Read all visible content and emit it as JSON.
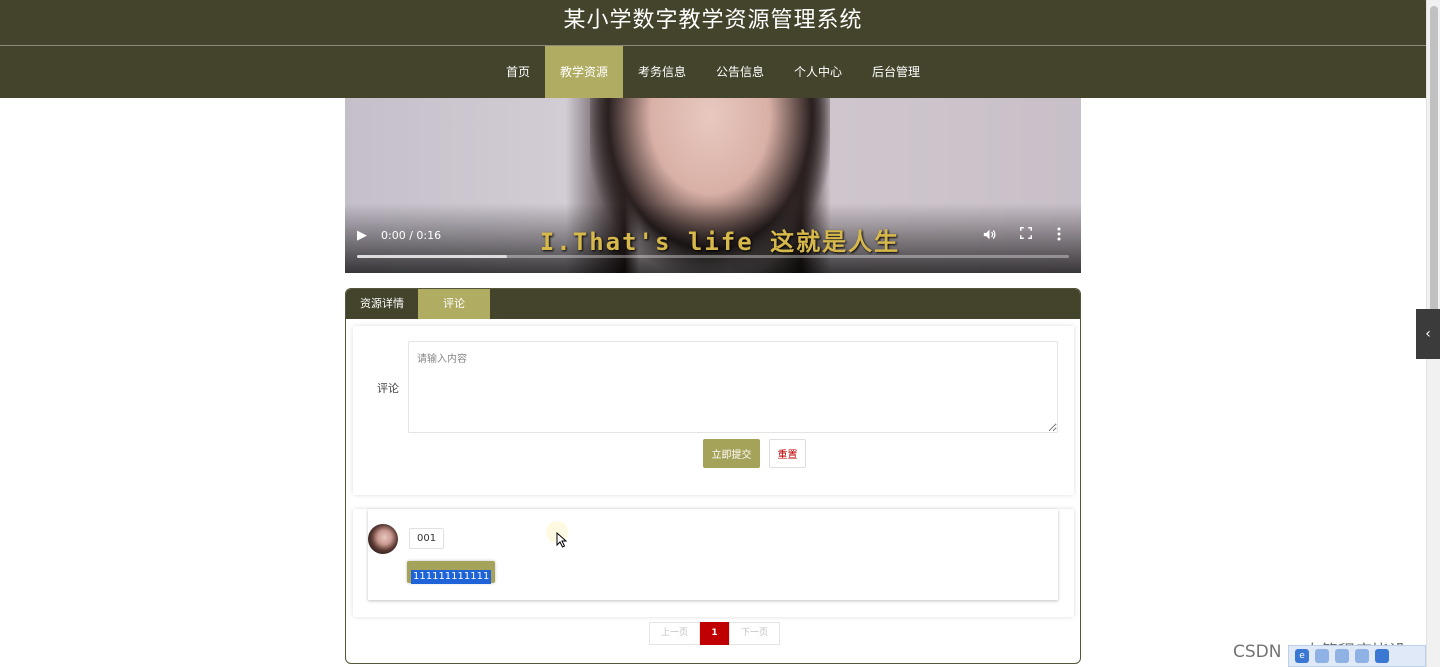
{
  "header": {
    "title": "某小学数字教学资源管理系统",
    "nav": [
      {
        "label": "首页",
        "active": false
      },
      {
        "label": "教学资源",
        "active": true
      },
      {
        "label": "考务信息",
        "active": false
      },
      {
        "label": "公告信息",
        "active": false
      },
      {
        "label": "个人中心",
        "active": false
      },
      {
        "label": "后台管理",
        "active": false
      }
    ]
  },
  "video": {
    "subtitle": "I.That's life 这就是人生",
    "time": "0:00 / 0:16",
    "progress_fraction": 0.21
  },
  "panel": {
    "tabs": [
      {
        "label": "资源详情",
        "active": false
      },
      {
        "label": "评论",
        "active": true
      }
    ],
    "form": {
      "label": "评论",
      "placeholder": "请输入内容",
      "value": "",
      "submit_label": "立即提交",
      "reset_label": "重置"
    },
    "comments": [
      {
        "user": "001",
        "text": "111111111111"
      }
    ],
    "pager": {
      "prev_label": "上一页",
      "current_page": "1",
      "next_label": "下一页"
    }
  },
  "overlay": {
    "watermark": "CSDN @太简程序毕设"
  },
  "colors": {
    "header_bg": "#44442c",
    "accent": "#b0ac62",
    "button": "#a5a35a",
    "danger": "#c00000"
  }
}
